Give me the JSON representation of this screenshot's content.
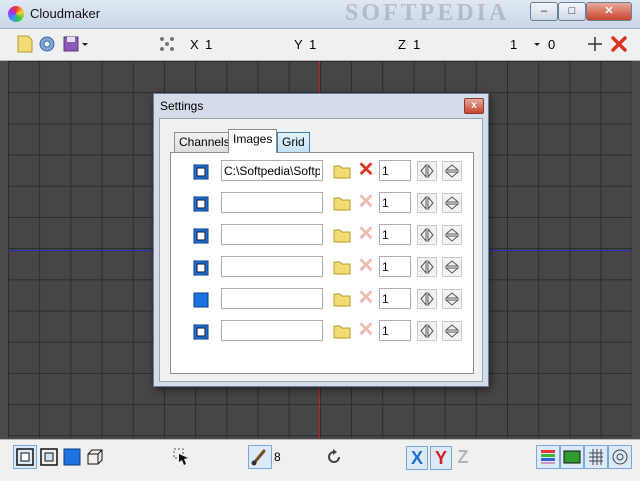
{
  "window": {
    "title": "Cloudmaker",
    "watermark": "SOFTPEDIA",
    "minimize": "–",
    "maximize": "□",
    "close": "✕"
  },
  "toolbar": {
    "x_label": "X",
    "x_value": "1",
    "y_label": "Y",
    "y_value": "1",
    "z_label": "Z",
    "z_value": "1",
    "spin_value": "1",
    "spin_value2": "0"
  },
  "dialog": {
    "title": "Settings",
    "close": "x",
    "tabs": [
      "Channels",
      "Images",
      "Grid"
    ],
    "active_tab": "Images",
    "rows": [
      {
        "path": "C:\\Softpedia\\Softpe",
        "count": "1",
        "delete_enabled": true
      },
      {
        "path": "",
        "count": "1",
        "delete_enabled": false
      },
      {
        "path": "",
        "count": "1",
        "delete_enabled": false
      },
      {
        "path": "",
        "count": "1",
        "delete_enabled": false
      },
      {
        "path": "",
        "count": "1",
        "delete_enabled": false
      },
      {
        "path": "",
        "count": "1",
        "delete_enabled": false
      }
    ]
  },
  "bottombar": {
    "brush_size": "8",
    "axis_x": "X",
    "axis_y": "Y",
    "axis_z": "Z"
  },
  "colors": {
    "axis_vertical": "#c81e1e",
    "axis_horizontal": "#2a2ac8",
    "delete_active": "#d9341f",
    "delete_disabled": "#f0b9b0",
    "axis_x_color": "#1f6fd0",
    "axis_y_color": "#d42020",
    "axis_z_color": "#b5b5b5"
  }
}
